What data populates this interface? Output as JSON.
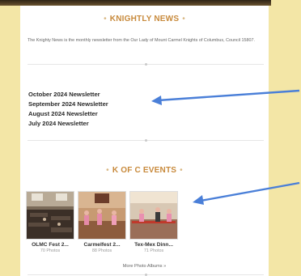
{
  "news": {
    "title": "KNIGHTLY NEWS",
    "intro": "The Knighty News is the monthly newsletter from the Our Lady of Mount Carmel Knights of Columbus, Council 15807.",
    "newsletters": [
      "October 2024 Newsletter",
      "September 2024 Newsletter",
      "August 2024 Newsletter",
      "July 2024 Newsletter"
    ]
  },
  "events": {
    "title": "K OF C EVENTS",
    "albums": [
      {
        "name": "OLMC Fest 2...",
        "count": "70 Photos"
      },
      {
        "name": "Carmelfest 2...",
        "count": "88 Photos"
      },
      {
        "name": "Tex-Mex Dinn...",
        "count": "71 Photos"
      }
    ],
    "more_label": "More Photo Albums »"
  },
  "colors": {
    "page_bg": "#f3e6a6",
    "accent": "#c88a3c",
    "arrow": "#4a7fd8"
  },
  "icons": {
    "dot": "•"
  }
}
